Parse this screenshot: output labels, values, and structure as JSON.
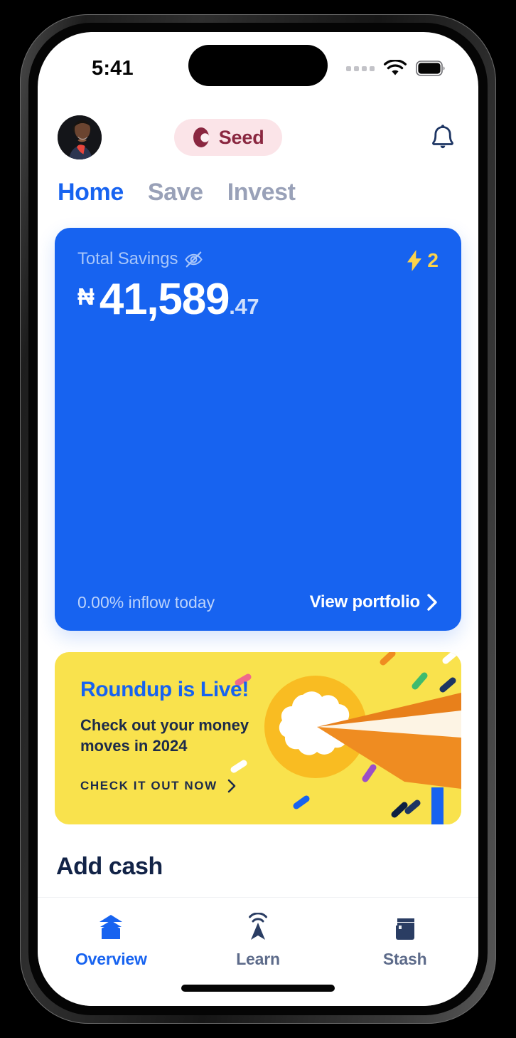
{
  "status_bar": {
    "time": "5:41",
    "signal_icon": "signal-dots-icon",
    "wifi_icon": "wifi-icon",
    "battery_icon": "battery-icon"
  },
  "header": {
    "avatar": "user-avatar",
    "logo_text": "Seed",
    "logo_mark": "seed-logo-icon",
    "notification_icon": "bell-icon"
  },
  "tabs": [
    {
      "label": "Home",
      "active": true
    },
    {
      "label": "Save",
      "active": false
    },
    {
      "label": "Invest",
      "active": false
    }
  ],
  "balance_card": {
    "label": "Total Savings",
    "visibility_icon": "eye-off-icon",
    "currency": "₦",
    "amount_main": "41,589",
    "amount_decimal": ".47",
    "streak_icon": "lightning-bolt-icon",
    "streak_count": "2",
    "inflow_text": "0.00% inflow today",
    "portfolio_link": "View portfolio",
    "chevron_icon": "chevron-right-icon"
  },
  "roundup_card": {
    "title": "Roundup is Live!",
    "subtitle": "Check out your money moves in 2024",
    "cta_label": "CHECK IT OUT NOW",
    "cta_icon": "chevron-right-icon",
    "illustration": "confetti-popper-illustration"
  },
  "section": {
    "add_cash_title": "Add cash"
  },
  "bottom_nav": [
    {
      "label": "Overview",
      "icon": "layers-home-icon",
      "active": true
    },
    {
      "label": "Learn",
      "icon": "antenna-signal-icon",
      "active": false
    },
    {
      "label": "Stash",
      "icon": "book-stash-icon",
      "active": false
    }
  ],
  "colors": {
    "accent_blue": "#1763f0",
    "card_blue": "#1763f0",
    "yellow": "#f9e24d",
    "navy": "#122347",
    "maroon": "#8a2740",
    "pink_pill": "#fbe4e8",
    "streak_yellow": "#fcd34b"
  }
}
